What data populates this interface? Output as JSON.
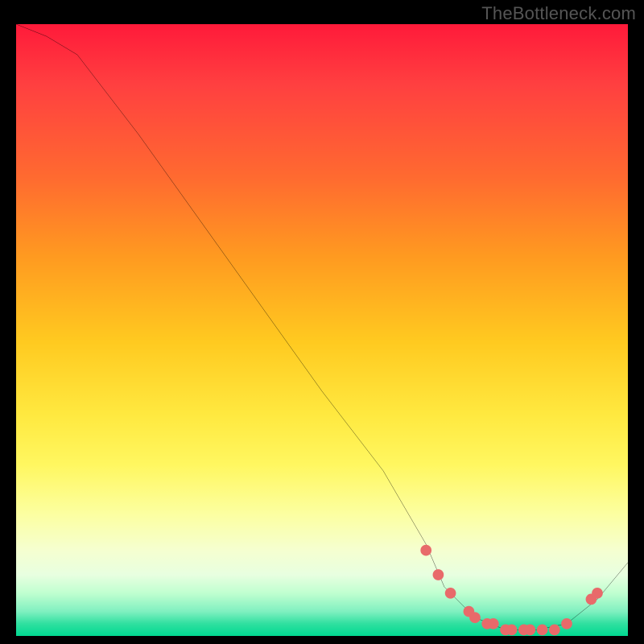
{
  "watermark": "TheBottleneck.com",
  "chart_data": {
    "type": "line",
    "title": "",
    "xlabel": "",
    "ylabel": "",
    "xlim": [
      0,
      100
    ],
    "ylim": [
      0,
      100
    ],
    "grid": false,
    "series": [
      {
        "name": "curve",
        "x": [
          0,
          5,
          10,
          20,
          30,
          40,
          50,
          60,
          67,
          70,
          75,
          80,
          85,
          90,
          95,
          100
        ],
        "y": [
          100,
          98,
          95,
          82,
          68,
          54,
          40,
          27,
          15,
          8,
          3,
          1,
          1,
          2,
          6,
          12
        ]
      }
    ],
    "points_overlay": {
      "name": "markers",
      "x": [
        67,
        69,
        71,
        74,
        75,
        77,
        78,
        80,
        81,
        83,
        84,
        86,
        88,
        90,
        94,
        95
      ],
      "y": [
        14,
        10,
        7,
        4,
        3,
        2,
        2,
        1,
        1,
        1,
        1,
        1,
        1,
        2,
        6,
        7
      ]
    },
    "colors": {
      "curve": "#000000",
      "markers": "#e86a6a",
      "background_top": "#ff1a3a",
      "background_bottom": "#00d890",
      "frame": "#000000"
    }
  }
}
